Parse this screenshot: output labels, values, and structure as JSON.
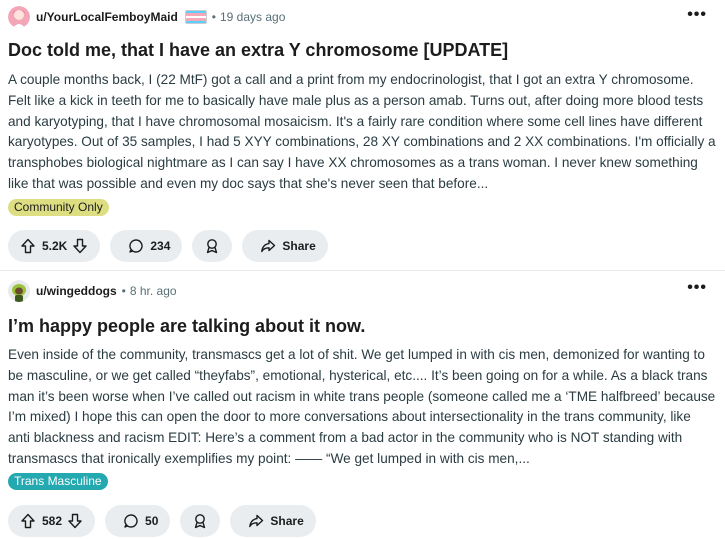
{
  "posts": [
    {
      "author": "u/YourLocalFemboyMaid",
      "time": "19 days ago",
      "title": "Doc told me, that I have an extra Y chromosome [UPDATE]",
      "body": "A couple months back, I (22 MtF) got a call and a print from my endocrinologist, that I got an extra Y chromosome. Felt like a kick in teeth for me to basically have male plus as a person amab. Turns out, after doing more blood tests and karyotyping, that I have chromosomal mosaicism. It's a fairly rare condition where some cell lines have different karyotypes. Out of 35 samples, I had 5 XYY combinations, 28 XY combinations and 2 XX combinations. I'm officially a transphobes biological nightmare as I can say I have XX chromosomes as a trans woman. I never knew something like that was possible and even my doc says that she's never seen that before...",
      "flair": "Community Only",
      "votes": "5.2K",
      "comments": "234",
      "share_label": "Share",
      "more": "•••"
    },
    {
      "author": "u/wingeddogs",
      "time": "8 hr. ago",
      "title": "I’m happy people are talking about it now.",
      "body": "Even inside of the community, transmascs get a lot of shit. We get lumped in with cis men, demonized for wanting to be masculine, or we get called “theyfabs”, emotional, hysterical, etc.... It’s been going on for a while. As a black trans man it’s been worse when I’ve called out racism in white trans people (someone called me a ‘TME halfbreed’ because I’m mixed) I hope this can open the door to more conversations about intersectionality in the trans community, like anti blackness and racism EDIT: Here’s a comment from a bad actor in the community who is NOT standing with transmascs that ironically exemplifies my point: —— “We get lumped in with cis men,...",
      "flair": "Trans Masculine",
      "votes": "582",
      "comments": "50",
      "share_label": "Share",
      "more": "•••"
    }
  ],
  "separator": "•",
  "colors": {
    "flair_community_only": "#ddde81",
    "flair_trans_masculine": "#24a9b0",
    "pill_background": "#e9edef",
    "meta_text": "#576f76",
    "trans_flag": [
      "#5bcefa",
      "#f5a9b8",
      "#ffffff",
      "#f5a9b8",
      "#5bcefa"
    ]
  },
  "icons": [
    "upvote-icon",
    "downvote-icon",
    "comment-icon",
    "award-icon",
    "share-icon",
    "more-icon",
    "avatar",
    "trans-flag"
  ]
}
